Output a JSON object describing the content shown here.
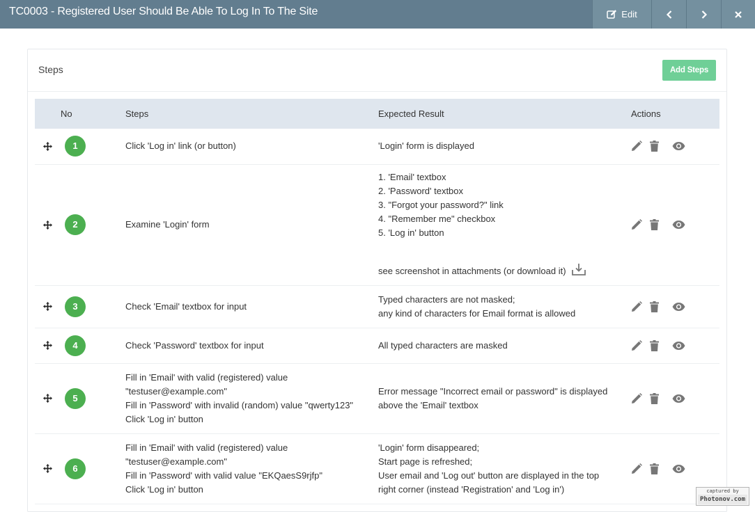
{
  "header": {
    "title": "TC0003 - Registered User Should Be Able To Log In To The Site",
    "edit_label": "Edit"
  },
  "panel": {
    "title": "Steps",
    "add_button_label": "Add Steps"
  },
  "table": {
    "columns": {
      "no": "No",
      "steps": "Steps",
      "expected": "Expected Result",
      "actions": "Actions"
    },
    "rows": [
      {
        "no": "1",
        "steps": [
          "Click 'Log in' link (or button)"
        ],
        "expected": [
          "'Login' form is displayed"
        ]
      },
      {
        "no": "2",
        "steps": [
          "Examine 'Login' form"
        ],
        "expected": [
          "1. 'Email' textbox",
          "2. 'Password' textbox",
          "3. \"Forgot your password?\" link",
          "4. \"Remember me\" checkbox",
          "5. 'Log in' button"
        ],
        "expected_note": "see screenshot in attachments (or download it)"
      },
      {
        "no": "3",
        "steps": [
          "Check 'Email' textbox for input"
        ],
        "expected": [
          "Typed characters are not masked;",
          "any kind of characters for Email format is allowed"
        ]
      },
      {
        "no": "4",
        "steps": [
          "Check 'Password' textbox for input"
        ],
        "expected": [
          "All typed characters are masked"
        ]
      },
      {
        "no": "5",
        "steps": [
          "Fill in 'Email' with valid (registered) value",
          "\"testuser@example.com\"",
          "Fill in 'Password' with invalid (random) value \"qwerty123\"",
          "Click 'Log in' button"
        ],
        "expected": [
          "Error message \"Incorrect email or password\" is displayed",
          "above the 'Email' textbox"
        ]
      },
      {
        "no": "6",
        "steps": [
          "Fill in 'Email' with valid (registered) value",
          "\"testuser@example.com\"",
          "Fill in 'Password' with valid value \"EKQaesS9rjfp\"",
          "Click 'Log in' button"
        ],
        "expected": [
          "'Login' form disappeared;",
          "Start page is refreshed;",
          "User email and 'Log out' button are displayed in the top",
          "right corner (instead 'Registration' and 'Log in')"
        ]
      }
    ]
  },
  "watermark": {
    "line1": "captured by",
    "line2": "Photonov.com"
  },
  "icons": {
    "edit": "pencil-square-icon",
    "prev": "chevron-left-icon",
    "next": "chevron-right-icon",
    "close": "close-icon",
    "drag": "move-arrows-icon",
    "row_edit": "pencil-icon",
    "row_delete": "trash-icon",
    "row_view": "eye-icon",
    "download": "download-icon"
  },
  "colors": {
    "header_bg": "#627d8f",
    "header_button_bg": "#74909f",
    "add_button": "#6fcf97",
    "step_badge": "#4caf50",
    "table_head_bg": "#dfe6ee",
    "action_icon": "#777777"
  }
}
